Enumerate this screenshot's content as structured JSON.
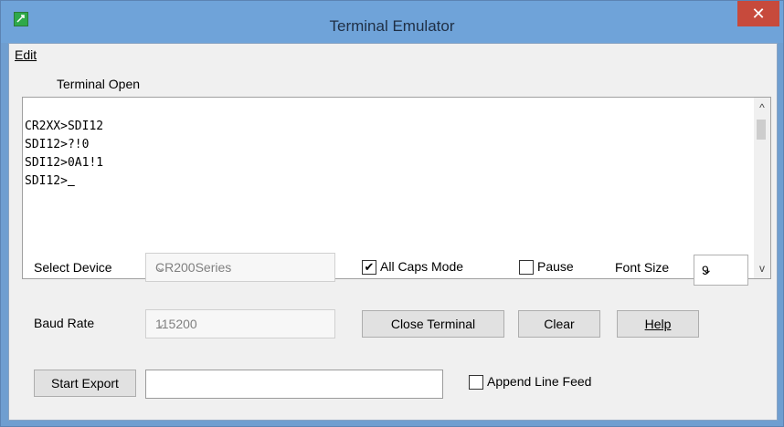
{
  "window": {
    "title": "Terminal Emulator",
    "close_glyph": "✕"
  },
  "menu": {
    "edit": "Edit"
  },
  "status": "Terminal Open",
  "terminal": {
    "lines": [
      "CR2XX>SDI12",
      "SDI12>?!0",
      "SDI12>0A1!1",
      "SDI12>"
    ],
    "scroll_up_glyph": "^",
    "scroll_down_glyph": "v"
  },
  "controls": {
    "select_device_label": "Select Device",
    "select_device_value": "CR200Series",
    "baud_rate_label": "Baud Rate",
    "baud_rate_value": "115200",
    "all_caps_label": "All Caps Mode",
    "all_caps_checked": true,
    "pause_label": "Pause",
    "pause_checked": false,
    "font_size_label": "Font Size",
    "font_size_value": "9",
    "close_terminal": "Close Terminal",
    "clear": "Clear",
    "help": "Help",
    "start_export": "Start Export",
    "export_path_value": "",
    "append_line_feed_label": "Append Line Feed",
    "append_line_feed_checked": false,
    "check_glyph": "✔",
    "chevron_glyph": "⌄"
  }
}
